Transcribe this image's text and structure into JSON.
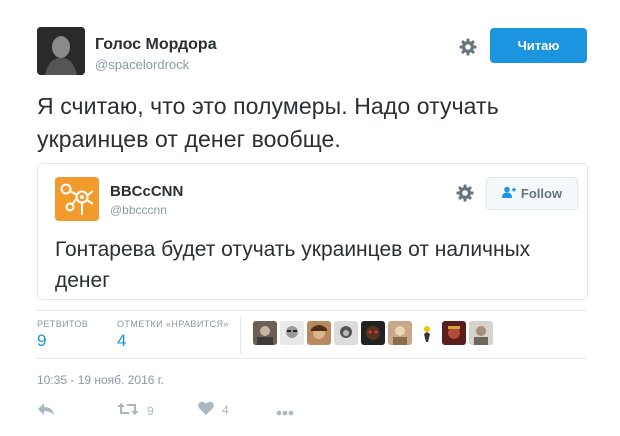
{
  "author": {
    "name": "Голос Мордора",
    "handle": "@spacelordrock"
  },
  "header": {
    "follow_label": "Читаю"
  },
  "tweet": {
    "text": "Я считаю, что это полумеры. Надо отучать украинцев от денег вообще."
  },
  "quoted": {
    "name": "BBCcCNN",
    "handle": "@bbcccnn",
    "follow_label": "Follow",
    "text": "Гонтарева будет отучать украинцев от наличных денег"
  },
  "stats": {
    "retweets_label": "РЕТВИТОВ",
    "retweets_value": "9",
    "likes_label": "ОТМЕТКИ «НРАВИТСЯ»",
    "likes_value": "4"
  },
  "timestamp": "10:35 - 19 нояб. 2016 г.",
  "actions": {
    "retweet_count": "9",
    "like_count": "4"
  },
  "colors": {
    "accent": "#1b95e0",
    "like": "#aab8c2",
    "quoted_avatar": "#f29b2c"
  },
  "icons": [
    "settings-gear-icon",
    "reply-icon",
    "retweet-icon",
    "heart-icon",
    "more-dots-icon",
    "add-user-icon"
  ]
}
